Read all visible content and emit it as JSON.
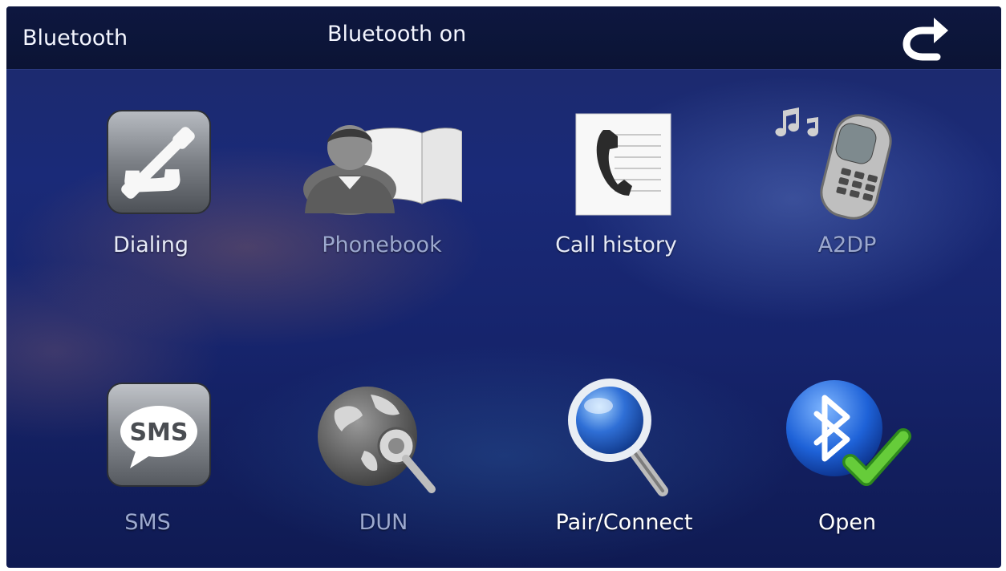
{
  "header": {
    "title": "Bluetooth",
    "status": "Bluetooth on",
    "back_icon": "back-arrow-icon"
  },
  "menu": {
    "items": [
      {
        "label": "Dialing",
        "icon": "phone-handset-icon"
      },
      {
        "label": "Phonebook",
        "icon": "phonebook-icon"
      },
      {
        "label": "Call history",
        "icon": "call-history-icon"
      },
      {
        "label": "A2DP",
        "icon": "music-phone-icon"
      },
      {
        "label": "SMS",
        "icon": "sms-bubble-icon"
      },
      {
        "label": "DUN",
        "icon": "globe-cable-icon"
      },
      {
        "label": "Pair/Connect",
        "icon": "magnifier-icon"
      },
      {
        "label": "Open",
        "icon": "bluetooth-check-icon"
      }
    ],
    "sms_icon_text": "SMS"
  },
  "colors": {
    "background": "#16246c",
    "topbar": "#0e1740",
    "text": "#f4f6ff",
    "dim_text": "#9ca9cf",
    "check_green": "#5cc23a",
    "bluetooth_blue": "#1e62d8"
  }
}
